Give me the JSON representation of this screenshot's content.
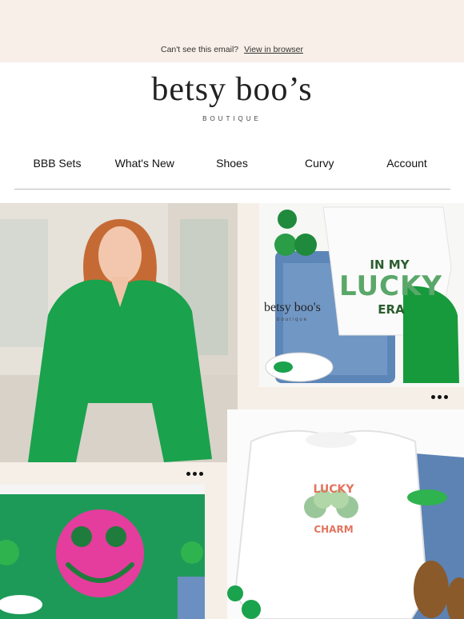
{
  "header": {
    "notice_text": "Can't see this email?",
    "view_link": "View in browser"
  },
  "brand": {
    "name": "betsy boo’s",
    "subtitle": "BOUTIQUE"
  },
  "nav": [
    {
      "label": "BBB Sets"
    },
    {
      "label": "What's New"
    },
    {
      "label": "Shoes"
    },
    {
      "label": "Curvy"
    },
    {
      "label": "Account"
    }
  ],
  "products": {
    "lucky_tee_text_1": "IN MY",
    "lucky_tee_text_2": "LUCKY",
    "lucky_tee_text_3": "ERA",
    "watermark": "betsy boo's",
    "watermark_sub": "boutique",
    "sweatshirt_text_1": "LUCKY",
    "sweatshirt_text_2": "CHARM"
  },
  "colors": {
    "kelly_green": "#1aa24d",
    "pink": "#e43d9d",
    "peach_band": "#f8efe8"
  }
}
